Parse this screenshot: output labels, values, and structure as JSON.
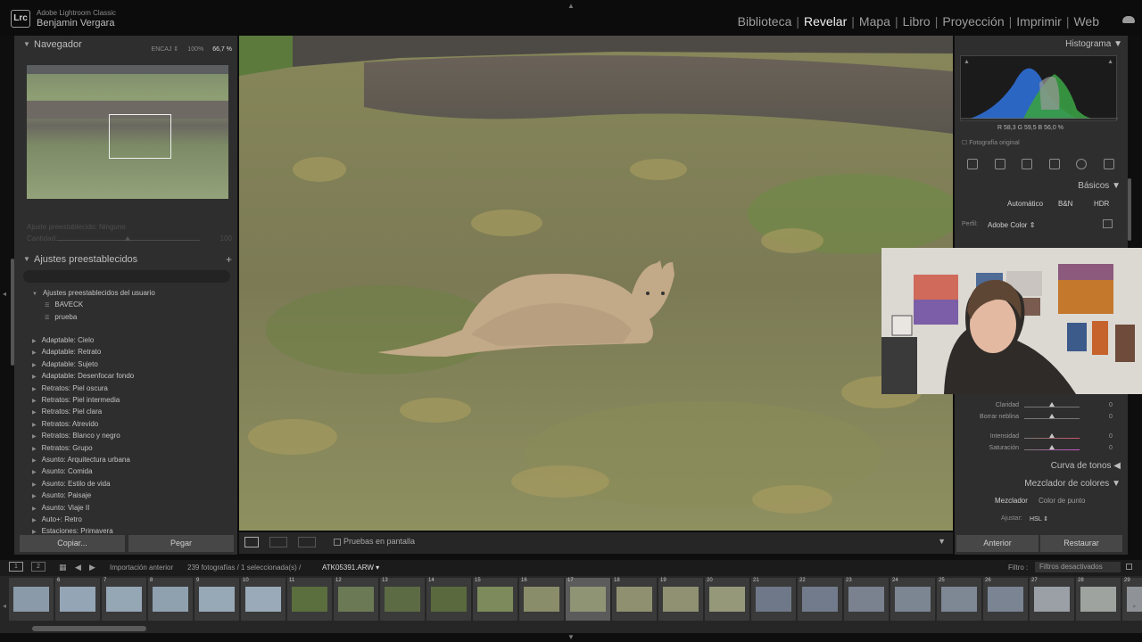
{
  "app": {
    "name": "Adobe Lightroom Classic",
    "user": "Benjamin Vergara",
    "logo": "Lrc"
  },
  "modules": [
    "Biblioteca",
    "Revelar",
    "Mapa",
    "Libro",
    "Proyección",
    "Imprimir",
    "Web"
  ],
  "active_module": "Revelar",
  "left": {
    "navigator": {
      "title": "Navegador",
      "zoom": [
        "ENCAJ ⇕",
        "100%",
        "66,7 %"
      ]
    },
    "dim": {
      "line1": "Ajuste preestablecido: Ninguno",
      "line2": "Cantidad:",
      "val": "100"
    },
    "presets": {
      "title": "Ajustes preestablecidos",
      "user_group": "Ajustes preestablecidos del usuario",
      "user_items": [
        "BAVECK",
        "prueba"
      ],
      "groups": [
        "Adaptable: Cielo",
        "Adaptable: Retrato",
        "Adaptable: Sujeto",
        "Adaptable: Desenfocar fondo",
        "Retratos: Piel oscura",
        "Retratos: Piel intermedia",
        "Retratos: Piel clara",
        "Retratos: Atrevido",
        "Retratos: Blanco y negro",
        "Retratos: Grupo",
        "Asunto: Arquitectura urbana",
        "Asunto: Comida",
        "Asunto: Estilo de vida",
        "Asunto: Paisaje",
        "Asunto: Viaje II",
        "Auto+: Retro",
        "Estaciones: Primavera"
      ]
    },
    "copy": "Copiar...",
    "paste": "Pegar"
  },
  "toolbar": {
    "proof": "Pruebas en pantalla"
  },
  "right": {
    "histogram": "Histograma",
    "rgb": "R  58,3   G  59,5   B  56,0 %",
    "original": "Fotografía original",
    "basics": "Básicos",
    "modes": [
      "Automático",
      "B&N",
      "HDR"
    ],
    "profile_label": "Perfil:",
    "profile": "Adobe Color ⇕",
    "sliders": [
      {
        "label": "Claridad",
        "val": "0"
      },
      {
        "label": "Borrar neblina",
        "val": "0"
      },
      {
        "label": "Intensidad",
        "val": "0"
      },
      {
        "label": "Saturación",
        "val": "0"
      }
    ],
    "tone_curve": "Curva de tonos",
    "mixer": "Mezclador de colores",
    "mixer_tabs": [
      "Mezclador",
      "Color de punto"
    ],
    "adjust_label": "Ajustar:",
    "adjust": "HSL ⇕",
    "prev": "Anterior",
    "reset": "Restaurar"
  },
  "filmbar": {
    "source": "Importación anterior",
    "count": "239 fotografías / 1 seleccionada(s) /",
    "file": "ATK05391.ARW ▾",
    "filter_label": "Filtro :",
    "filter": "Filtros desactivados"
  },
  "film_numbers": [
    "",
    "6",
    "7",
    "8",
    "9",
    "10",
    "11",
    "12",
    "13",
    "14",
    "15",
    "16",
    "17",
    "18",
    "19",
    "20",
    "21",
    "22",
    "23",
    "24",
    "25",
    "26",
    "27",
    "28",
    "29"
  ],
  "selected_thumb": "17"
}
